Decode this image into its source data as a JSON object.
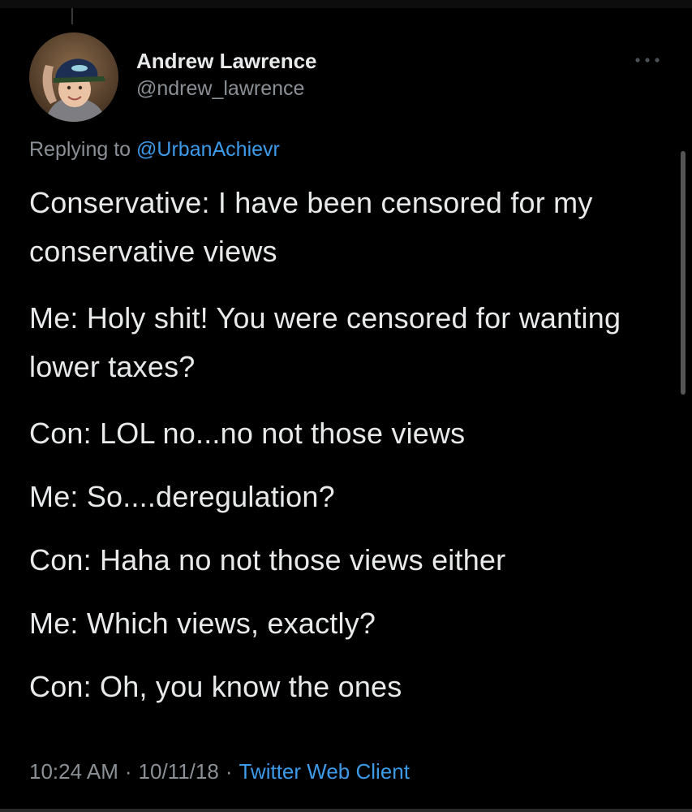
{
  "tweet": {
    "author": {
      "display_name": "Andrew Lawrence",
      "handle": "@ndrew_lawrence",
      "avatar_icon": "profile-photo-child-in-cap"
    },
    "more_icon": "more-horizontal-icon",
    "reply": {
      "prefix": "Replying to",
      "mention": "@UrbanAchievr"
    },
    "lines": [
      "Conservative: I have been censored for my conservative views",
      "Me: Holy shit! You were censored for wanting lower taxes?",
      "Con: LOL no...no not those views",
      "Me: So....deregulation?",
      "Con: Haha no not those views either",
      "Me: Which views, exactly?",
      "Con: Oh, you know the ones"
    ],
    "meta": {
      "time": "10:24 AM",
      "separator": "·",
      "date": "10/11/18",
      "client": "Twitter Web Client"
    }
  },
  "colors": {
    "background": "#000000",
    "text": "#e7e9ea",
    "secondary": "#8b9096",
    "link": "#3d9ae8"
  }
}
